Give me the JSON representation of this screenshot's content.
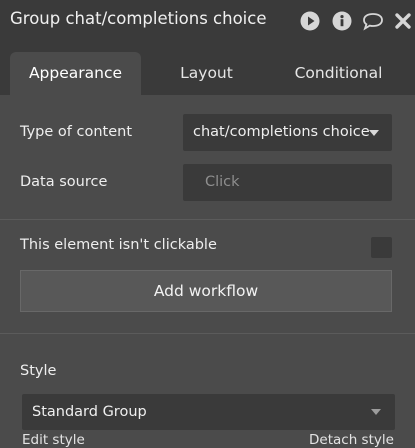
{
  "window": {
    "title": "Group chat/completions choice",
    "icons": [
      "play-icon",
      "info-icon",
      "comment-icon",
      "close-icon"
    ]
  },
  "tabs": [
    {
      "label": "Appearance",
      "active": true
    },
    {
      "label": "Layout",
      "active": false
    },
    {
      "label": "Conditional",
      "active": false
    }
  ],
  "fields": {
    "type_of_content_label": "Type of content",
    "type_of_content_value": "chat/completions choice",
    "data_source_label": "Data source",
    "data_source_placeholder": "Click"
  },
  "clickable": {
    "label": "This element isn't clickable",
    "checked": false
  },
  "workflow": {
    "button_label": "Add workflow"
  },
  "style": {
    "section_label": "Style",
    "value": "Standard Group",
    "edit_link": "Edit style",
    "detach_link": "Detach style"
  },
  "colors": {
    "panel_bg": "#4b4b4b",
    "header_bg": "#3a3a3a",
    "input_bg": "#3a3a3a",
    "button_bg": "#585858"
  }
}
